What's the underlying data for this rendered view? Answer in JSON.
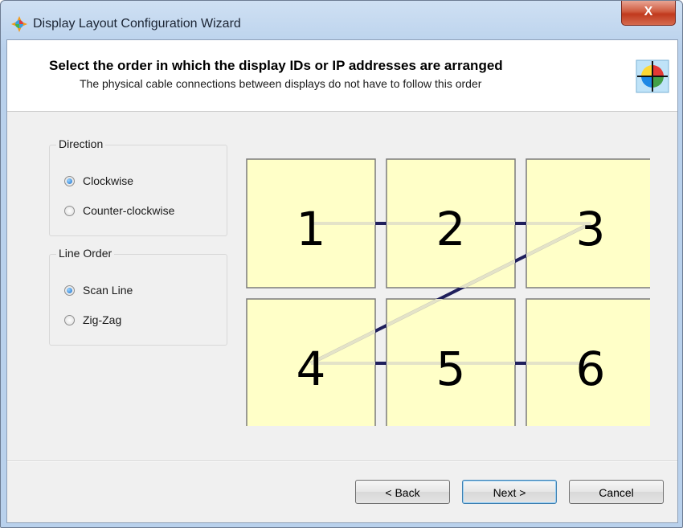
{
  "window": {
    "title": "Display Layout Configuration Wizard",
    "close_label": "X"
  },
  "header": {
    "title": "Select the order in which the display IDs or IP addresses are arranged",
    "subtitle": "The physical cable connections between displays do not have to follow this order"
  },
  "direction": {
    "label": "Direction",
    "options": [
      {
        "label": "Clockwise",
        "selected": true
      },
      {
        "label": "Counter-clockwise",
        "selected": false
      }
    ]
  },
  "line_order": {
    "label": "Line Order",
    "options": [
      {
        "label": "Scan Line",
        "selected": true
      },
      {
        "label": "Zig-Zag",
        "selected": false
      }
    ]
  },
  "displays": {
    "rows": 2,
    "cols": 3,
    "ids": [
      "1",
      "2",
      "3",
      "4",
      "5",
      "6"
    ],
    "tile_color": "#ffffc8",
    "connector_color": "#1f1f5c",
    "path_color": "#e4e3c8"
  },
  "buttons": {
    "back": "< Back",
    "next": "Next >",
    "cancel": "Cancel"
  }
}
